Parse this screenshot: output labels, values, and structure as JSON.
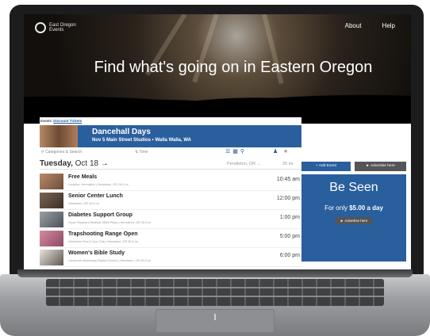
{
  "logo": {
    "text": "East Oregon Events",
    "icon": "logo-icon"
  },
  "nav": {
    "about": "About",
    "help": "Help"
  },
  "hero": {
    "title": "Find what's going on in Eastern Oregon"
  },
  "breadcrumb": {
    "label": "Events:",
    "link": "Discount Tickets"
  },
  "featured": {
    "title": "Dancehall Days",
    "details": "Nov 5   Main Street Studios   • Walla Walla, WA"
  },
  "toolbar": {
    "category_placeholder": "Categories & Search",
    "time_label": "Time",
    "icons": [
      "list-view-icon",
      "grid-view-icon",
      "map-pin-icon",
      "person-icon",
      "star-icon"
    ]
  },
  "day_header": {
    "weekday": "Tuesday,",
    "date": "Oct 18",
    "location": "Pendleton, OR",
    "radius": "30 mi"
  },
  "events": [
    {
      "title": "Free Meals",
      "meta": "Location: Hermiston | Hermiston, OR   26.9 mi",
      "time": "10:45 am"
    },
    {
      "title": "Senior Center Lunch",
      "meta": "Hermiston, OR   26.9 mi",
      "time": "12:00 pm"
    },
    {
      "title": "Diabetes Support Group",
      "meta": "Good Shepherd Medical Office Plaza | Hermiston, OR   26.9 mi",
      "time": "1:00 pm"
    },
    {
      "title": "Trapshooting Range Open",
      "meta": "Hermiston Rod & Gun Club | Hermiston, OR   26.9 mi",
      "time": "5:00 pm"
    },
    {
      "title": "Women's Bible Study",
      "meta": "Landmark Missionary Baptist Church | Hermiston, OR   26.9 mi",
      "time": "6:00 pm"
    }
  ],
  "rail": {
    "add_event": "+ Add Event",
    "advertise": "Advertise here",
    "ad_title": "Be Seen",
    "ad_prefix": "For only",
    "ad_price": "$5.00 a day",
    "ad_button": "Advertise here"
  },
  "colors": {
    "primary": "#2a5f9e",
    "secondary": "#555555"
  }
}
